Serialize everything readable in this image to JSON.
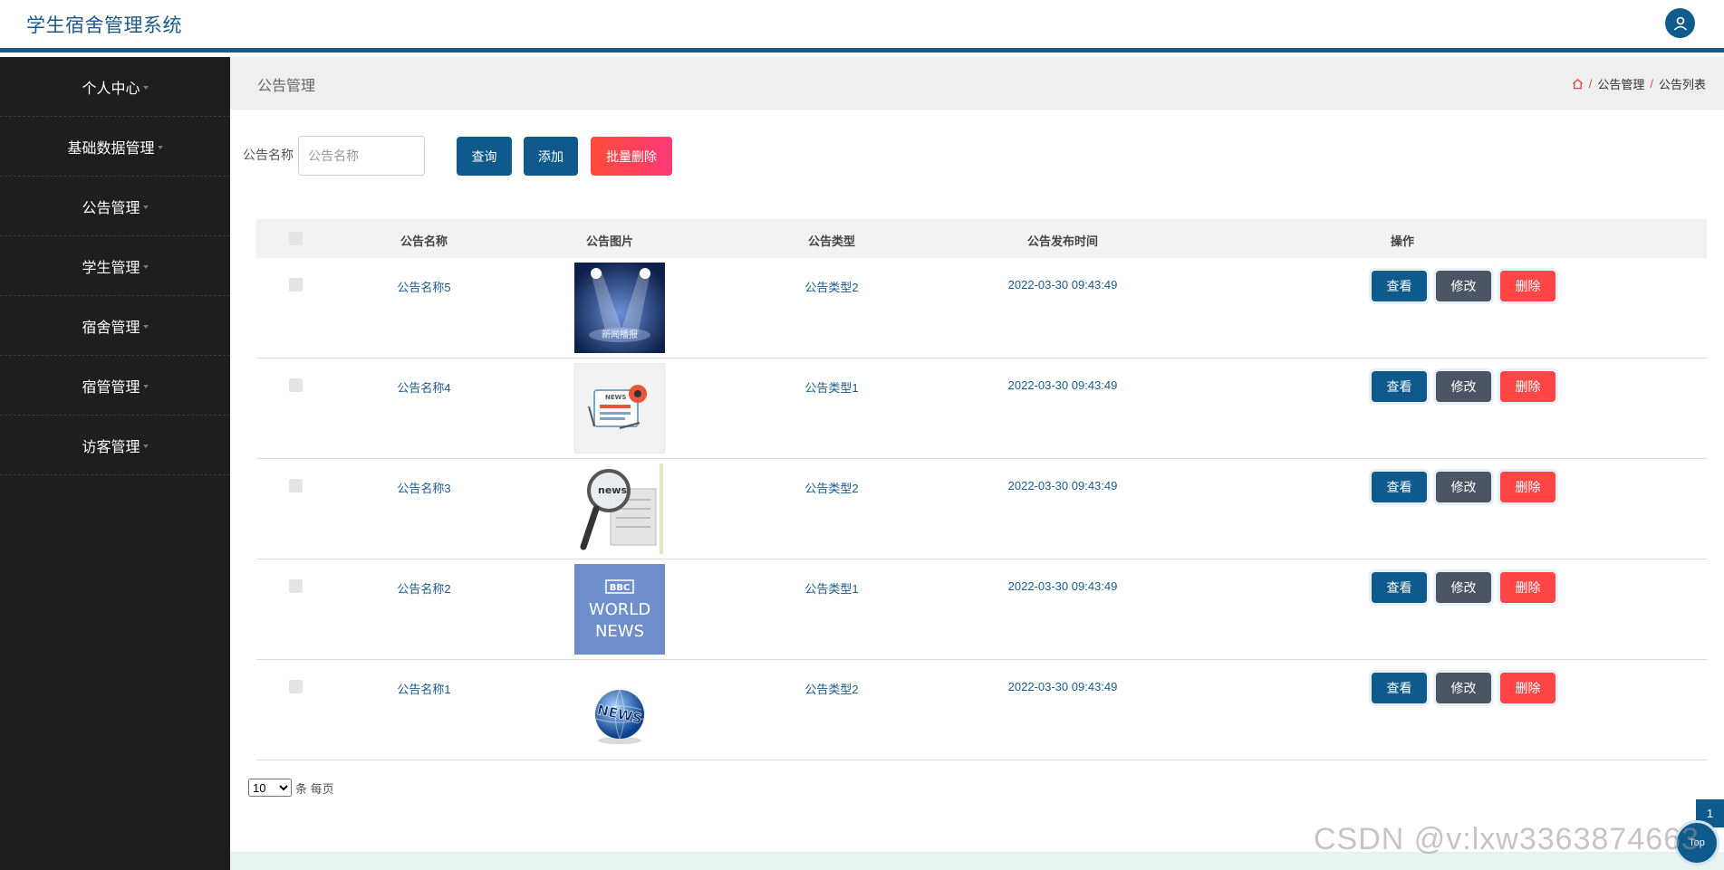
{
  "app": {
    "title": "学生宿舍管理系统"
  },
  "sidebar": {
    "items": [
      {
        "label": "个人中心"
      },
      {
        "label": "基础数据管理"
      },
      {
        "label": "公告管理"
      },
      {
        "label": "学生管理"
      },
      {
        "label": "宿舍管理"
      },
      {
        "label": "宿管管理"
      },
      {
        "label": "访客管理"
      }
    ]
  },
  "header": {
    "page_title": "公告管理",
    "breadcrumb": {
      "level1": "公告管理",
      "level2": "公告列表",
      "separator": "/"
    }
  },
  "search": {
    "label": "公告名称",
    "placeholder": "公告名称",
    "query_label": "查询",
    "add_label": "添加",
    "bulk_delete_label": "批量删除"
  },
  "table": {
    "columns": [
      "公告名称",
      "公告图片",
      "公告类型",
      "公告发布时间",
      "操作"
    ],
    "rows": [
      {
        "name": "公告名称5",
        "type": "公告类型2",
        "time": "2022-03-30 09:43:49",
        "image_alt": "新闻播报"
      },
      {
        "name": "公告名称4",
        "type": "公告类型1",
        "time": "2022-03-30 09:43:49",
        "image_alt": "NEWS"
      },
      {
        "name": "公告名称3",
        "type": "公告类型2",
        "time": "2022-03-30 09:43:49",
        "image_alt": "news"
      },
      {
        "name": "公告名称2",
        "type": "公告类型1",
        "time": "2022-03-30 09:43:49",
        "image_alt": "BBC WORLD NEWS"
      },
      {
        "name": "公告名称1",
        "type": "公告类型2",
        "time": "2022-03-30 09:43:49",
        "image_alt": "NEWS"
      }
    ],
    "actions": {
      "view": "查看",
      "edit": "修改",
      "delete": "删除"
    }
  },
  "pager": {
    "page_size": "10",
    "suffix": "条 每页"
  },
  "float": {
    "page_number": "1",
    "top_label": "Top"
  },
  "watermark": "CSDN @v:lxw3363874663",
  "colors": {
    "primary": "#0f5a8c",
    "danger": "#ff4545",
    "sidebar": "#1e1e1e"
  }
}
